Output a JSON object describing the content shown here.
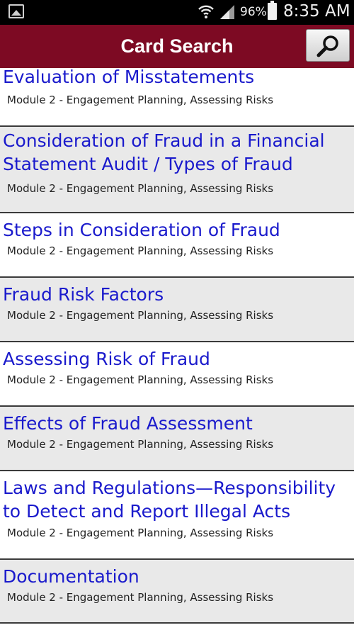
{
  "status_bar": {
    "battery_percent": "96%",
    "time": "8:35 AM",
    "icons": [
      "picture-icon",
      "wifi-icon",
      "signal-icon",
      "battery-icon"
    ]
  },
  "app_bar": {
    "title": "Card Search",
    "search_icon": "search-icon",
    "color": "#7d0a23"
  },
  "cards": [
    {
      "title": "Evaluation of Misstatements",
      "subtitle": "Module 2 - Engagement Planning,  Assessing Risks"
    },
    {
      "title": "Consideration of Fraud in a Financial Statement Audit / Types of Fraud",
      "subtitle": "Module 2 - Engagement Planning,  Assessing Risks"
    },
    {
      "title": "Steps in Consideration of Fraud",
      "subtitle": "Module 2 - Engagement Planning,  Assessing Risks"
    },
    {
      "title": "Fraud Risk Factors",
      "subtitle": "Module 2 - Engagement Planning,  Assessing Risks"
    },
    {
      "title": "Assessing Risk of Fraud",
      "subtitle": "Module 2 - Engagement Planning,  Assessing Risks"
    },
    {
      "title": "Effects of Fraud Assessment",
      "subtitle": "Module 2 - Engagement Planning,  Assessing Risks"
    },
    {
      "title": "Laws and Regulations—Responsibility to Detect and Report Illegal Acts",
      "subtitle": "Module 2 - Engagement Planning,  Assessing Risks"
    },
    {
      "title": "Documentation",
      "subtitle": "Module 2 - Engagement Planning,  Assessing Risks"
    }
  ]
}
